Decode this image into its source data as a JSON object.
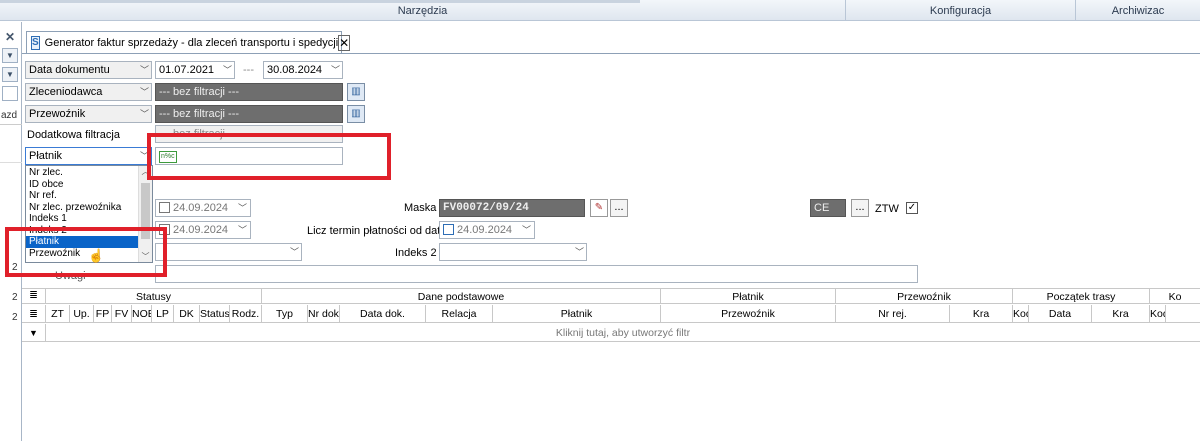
{
  "ribbon": {
    "groups": [
      "Narzędzia",
      "Konfiguracja",
      "Archiwizac"
    ]
  },
  "left_panel": {
    "close_glyph": "✕",
    "text_fragment": "azd",
    "row_numbers": [
      "2",
      "2",
      "2"
    ]
  },
  "tab": {
    "icon_letter": "S",
    "title": "Generator faktur sprzedaży - dla zleceń transportu i spedycji",
    "close_glyph": "✕"
  },
  "filters": {
    "date_field": "Data dokumentu",
    "date_from": "01.07.2021",
    "date_separator": "---",
    "date_to": "30.08.2024",
    "client_field": "Zleceniodawca",
    "client_value": "--- bez filtracji ---",
    "carrier_field": "Przewoźnik",
    "carrier_value": "--- bez filtracji ---",
    "extra_label": "Dodatkowa filtracja",
    "extra_value": "--- bez filtracji ---",
    "extra_combo": "Płatnik",
    "extra_input_icon": "n%c"
  },
  "dropdown": {
    "items": [
      "Nr zlec.",
      "ID obce",
      "Nr ref.",
      "Nr zlec. przewoźnika",
      "Indeks 1",
      "Indeks 2",
      "Płatnik",
      "Przewoźnik"
    ],
    "selected_index": 6
  },
  "params": {
    "date1": "24.09.2024",
    "date2": "24.09.2024",
    "mask_label": "Maska",
    "mask_value": "FV00072/09/24",
    "payment_label": "Licz termin płatności od daty",
    "payment_date": "24.09.2024",
    "index2_label": "Indeks 2",
    "currency_value": "CE",
    "dots": "...",
    "ztw_label": "ZTW",
    "ztw_checked": true,
    "notes_label": "Uwagi"
  },
  "grid": {
    "groups": [
      {
        "label": "Statusy"
      },
      {
        "label": "Dane podstawowe"
      },
      {
        "label": "Płatnik"
      },
      {
        "label": "Przewoźnik"
      },
      {
        "label": "Początek trasy"
      },
      {
        "label": "Ko"
      }
    ],
    "columns": [
      "ZT",
      "Up.",
      "FP",
      "FV",
      "NOB",
      "LP",
      "DK",
      "Status",
      "Rodz.",
      "Typ",
      "Nr dok.",
      "Data dok.",
      "Relacja",
      "Płatnik",
      "Przewoźnik",
      "Nr rej.",
      "Kra",
      "Kod poczt.",
      "Data",
      "Kra",
      "Kod p"
    ],
    "filter_hint": "Kliknij tutaj, aby utworzyć filtr"
  }
}
